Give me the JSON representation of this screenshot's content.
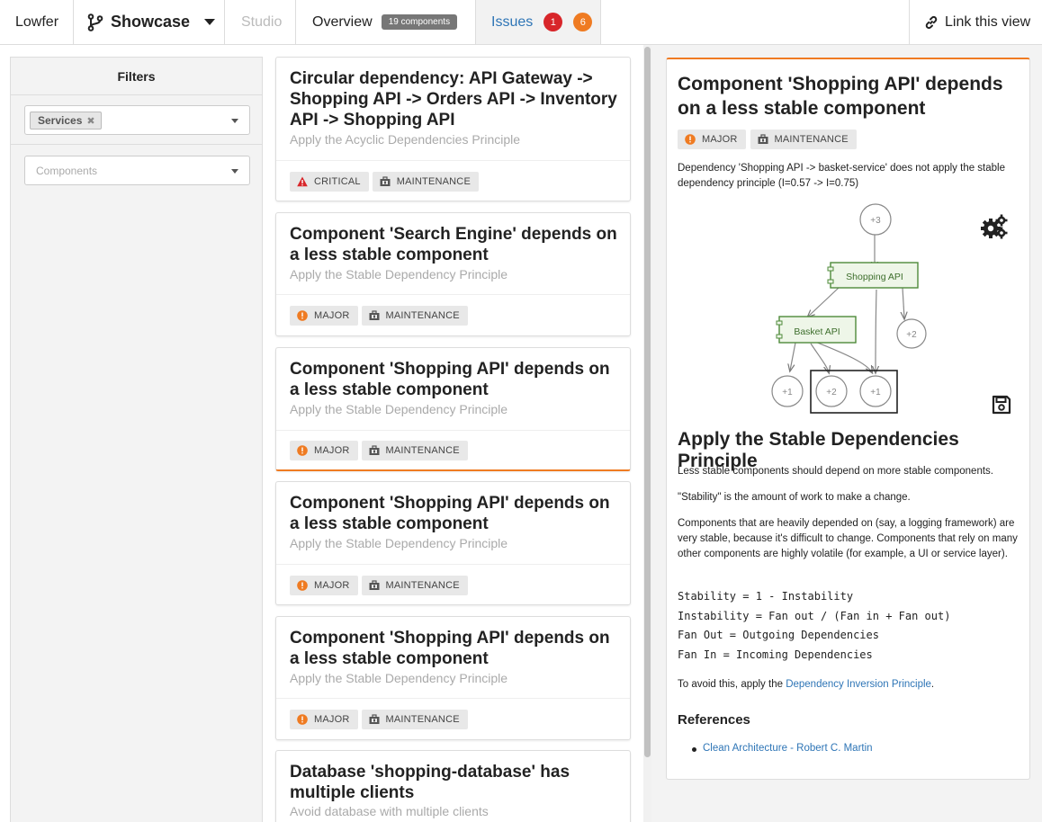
{
  "topbar": {
    "brand": "Lowfer",
    "project": "Showcase",
    "studio": "Studio",
    "overview": "Overview",
    "components_count": "19 components",
    "issues": "Issues",
    "critical_count": "1",
    "major_count": "6",
    "link_view": "Link this view"
  },
  "filters": {
    "title": "Filters",
    "selected_chip": "Services",
    "components_placeholder": "Components"
  },
  "issues": [
    {
      "title": "Circular dependency: API Gateway -> Shopping API -> Orders API -> Inventory API -> Shopping API",
      "principle": "Apply the Acyclic Dependencies Principle",
      "severity": "CRITICAL",
      "category": "MAINTENANCE"
    },
    {
      "title": "Component 'Search Engine' depends on a less stable component",
      "principle": "Apply the Stable Dependency Principle",
      "severity": "MAJOR",
      "category": "MAINTENANCE"
    },
    {
      "title": "Component 'Shopping API' depends on a less stable component",
      "principle": "Apply the Stable Dependency Principle",
      "severity": "MAJOR",
      "category": "MAINTENANCE"
    },
    {
      "title": "Component 'Shopping API' depends on a less stable component",
      "principle": "Apply the Stable Dependency Principle",
      "severity": "MAJOR",
      "category": "MAINTENANCE"
    },
    {
      "title": "Component 'Shopping API' depends on a less stable component",
      "principle": "Apply the Stable Dependency Principle",
      "severity": "MAJOR",
      "category": "MAINTENANCE"
    },
    {
      "title": "Database 'shopping-database' has multiple clients",
      "principle": "Avoid database with multiple clients"
    }
  ],
  "detail": {
    "title": "Component 'Shopping API' depends on a less stable component",
    "severity": "MAJOR",
    "category": "MAINTENANCE",
    "description": "Dependency 'Shopping API -> basket-service' does not apply the stable dependency principle (I=0.57 -> I=0.75)",
    "graph": {
      "top_node": "+3",
      "main_node": "Shopping API",
      "secondary_node": "Basket API",
      "right_node": "+2",
      "bottom_left": "+1",
      "bottom_middle": "+2",
      "bottom_right": "+1"
    },
    "principle_title": "Apply the Stable Dependencies Principle",
    "p1": "Less stable components should depend on more stable components.",
    "p2": "\"Stability\" is the amount of work to make a change.",
    "p3": "Components that are heavily depended on (say, a logging framework) are very stable, because it's difficult to change. Components that rely on many other components are highly volatile (for example, a UI or service layer).",
    "formula_1": "Stability = 1 - Instability",
    "formula_2": "Instability = Fan out / (Fan in + Fan out)",
    "formula_3": "Fan Out = Outgoing Dependencies",
    "formula_4": "Fan In = Incoming Dependencies",
    "avoid_prefix": "To avoid this, apply the ",
    "avoid_link": "Dependency Inversion Principle",
    "avoid_suffix": ".",
    "references_title": "References",
    "reference_1": "Clean Architecture - Robert C. Martin"
  },
  "colors": {
    "accent": "#ef7b22",
    "critical": "#d8262a",
    "link": "#2e75b6",
    "node_fill": "#eef6e8",
    "node_stroke": "#4e8a3a"
  }
}
